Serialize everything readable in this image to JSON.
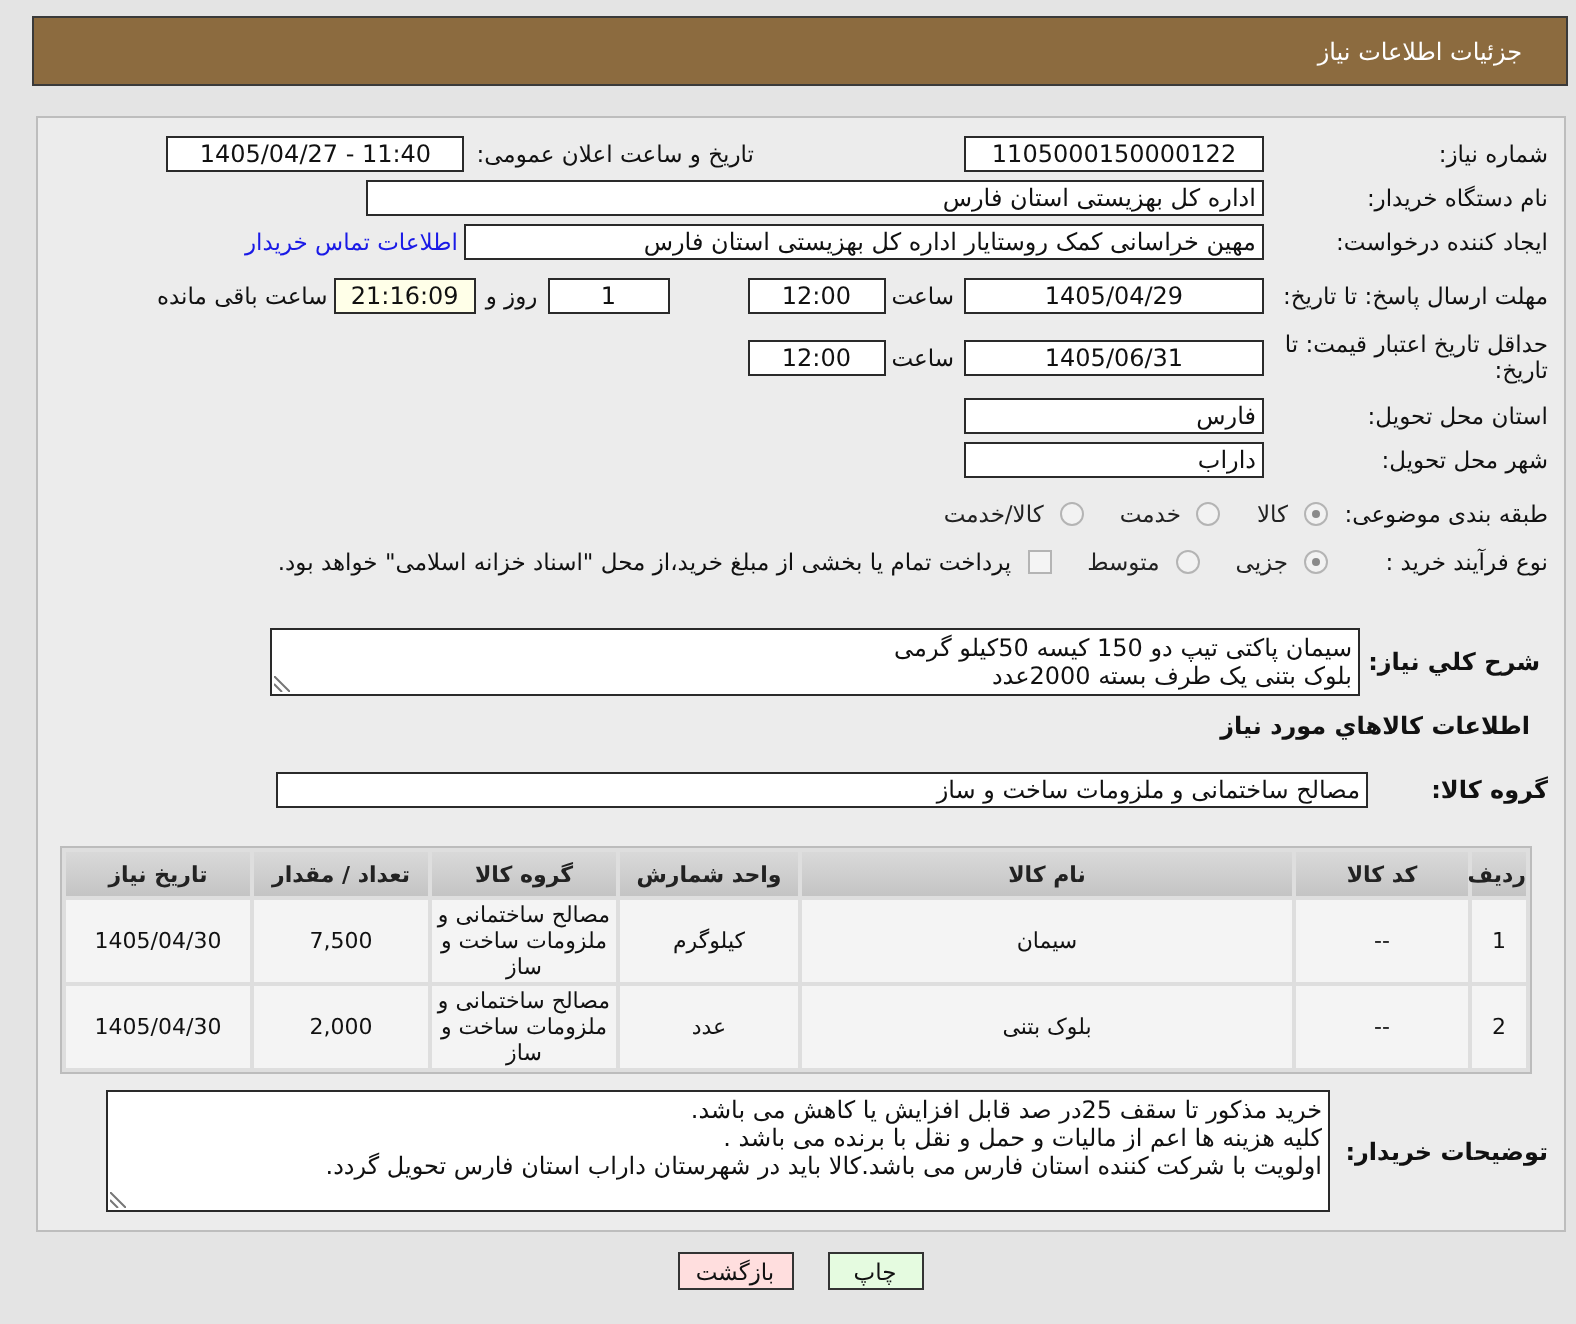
{
  "header": {
    "title": "جزئیات اطلاعات نیاز"
  },
  "need_number": {
    "label": "شماره نیاز:",
    "value": "1105000150000122"
  },
  "announcement": {
    "label": "تاریخ و ساعت اعلان عمومی:",
    "value": "1405/04/27 - 11:40"
  },
  "buyer_org": {
    "label": "نام دستگاه خریدار:",
    "value": "اداره کل بهزیستی استان فارس"
  },
  "requester": {
    "label": "ایجاد کننده درخواست:",
    "value": "مهین خراسانی کمک روستایار اداره کل بهزیستی استان فارس",
    "contact_link": "اطلاعات تماس خریدار"
  },
  "response_deadline": {
    "label": "مهلت ارسال پاسخ: تا تاریخ:",
    "date": "1405/04/29",
    "time_label": "ساعت",
    "time": "12:00",
    "days": "1",
    "days_label": "روز و",
    "remaining": "21:16:09",
    "remaining_label": "ساعت باقی مانده"
  },
  "price_validity": {
    "label": "حداقل تاریخ اعتبار قیمت: تا تاریخ:",
    "date": "1405/06/31",
    "time_label": "ساعت",
    "time": "12:00"
  },
  "delivery_province": {
    "label": "استان محل تحویل:",
    "value": "فارس"
  },
  "delivery_city": {
    "label": "شهر محل تحویل:",
    "value": "داراب"
  },
  "category": {
    "label": "طبقه بندی موضوعی:",
    "options": [
      {
        "label": "کالا",
        "selected": true
      },
      {
        "label": "خدمت",
        "selected": false
      },
      {
        "label": "کالا/خدمت",
        "selected": false
      }
    ]
  },
  "purchase_process": {
    "label": "نوع فرآیند خرید :",
    "options": [
      {
        "label": "جزیی",
        "selected": true
      },
      {
        "label": "متوسط",
        "selected": false
      }
    ],
    "treasury_payment": {
      "label": "پرداخت تمام یا بخشی از مبلغ خرید،از محل \"اسناد خزانه اسلامی\" خواهد بود.",
      "checked": false
    }
  },
  "description": {
    "label": "شرح کلي نياز:",
    "lines": [
      "سیمان پاکتی تیپ دو 150 کیسه 50کیلو گرمی",
      "بلوک بتنی یک طرف بسته 2000عدد"
    ]
  },
  "goods_heading": "اطلاعات كالاهاي مورد نياز",
  "goods_group": {
    "label": "گروه کالا:",
    "value": "مصالح ساختمانی و ملزومات ساخت و ساز"
  },
  "table": {
    "columns": [
      "ردیف",
      "کد کالا",
      "نام کالا",
      "واحد شمارش",
      "گروه کالا",
      "تعداد / مقدار",
      "تاریخ نیاز"
    ],
    "rows": [
      [
        "1",
        "--",
        "سیمان",
        "کیلوگرم",
        "مصالح ساختمانی و ملزومات ساخت و ساز",
        "7,500",
        "1405/04/30"
      ],
      [
        "2",
        "--",
        "بلوک بتنی",
        "عدد",
        "مصالح ساختمانی و ملزومات ساخت و ساز",
        "2,000",
        "1405/04/30"
      ]
    ]
  },
  "buyer_notes": {
    "label": "توضیحات خریدار:",
    "lines": [
      "خرید مذکور تا سقف 25در صد قابل افزایش یا کاهش می باشد.",
      "کلیه هزینه ها اعم از مالیات و حمل و نقل با برنده می باشد .",
      "اولویت با شرکت کننده استان فارس می باشد.کالا باید در شهرستان داراب استان فارس تحویل گردد."
    ]
  },
  "buttons": [
    {
      "kind": "print",
      "label": "چاپ"
    },
    {
      "kind": "back",
      "label": "بازگشت"
    }
  ]
}
